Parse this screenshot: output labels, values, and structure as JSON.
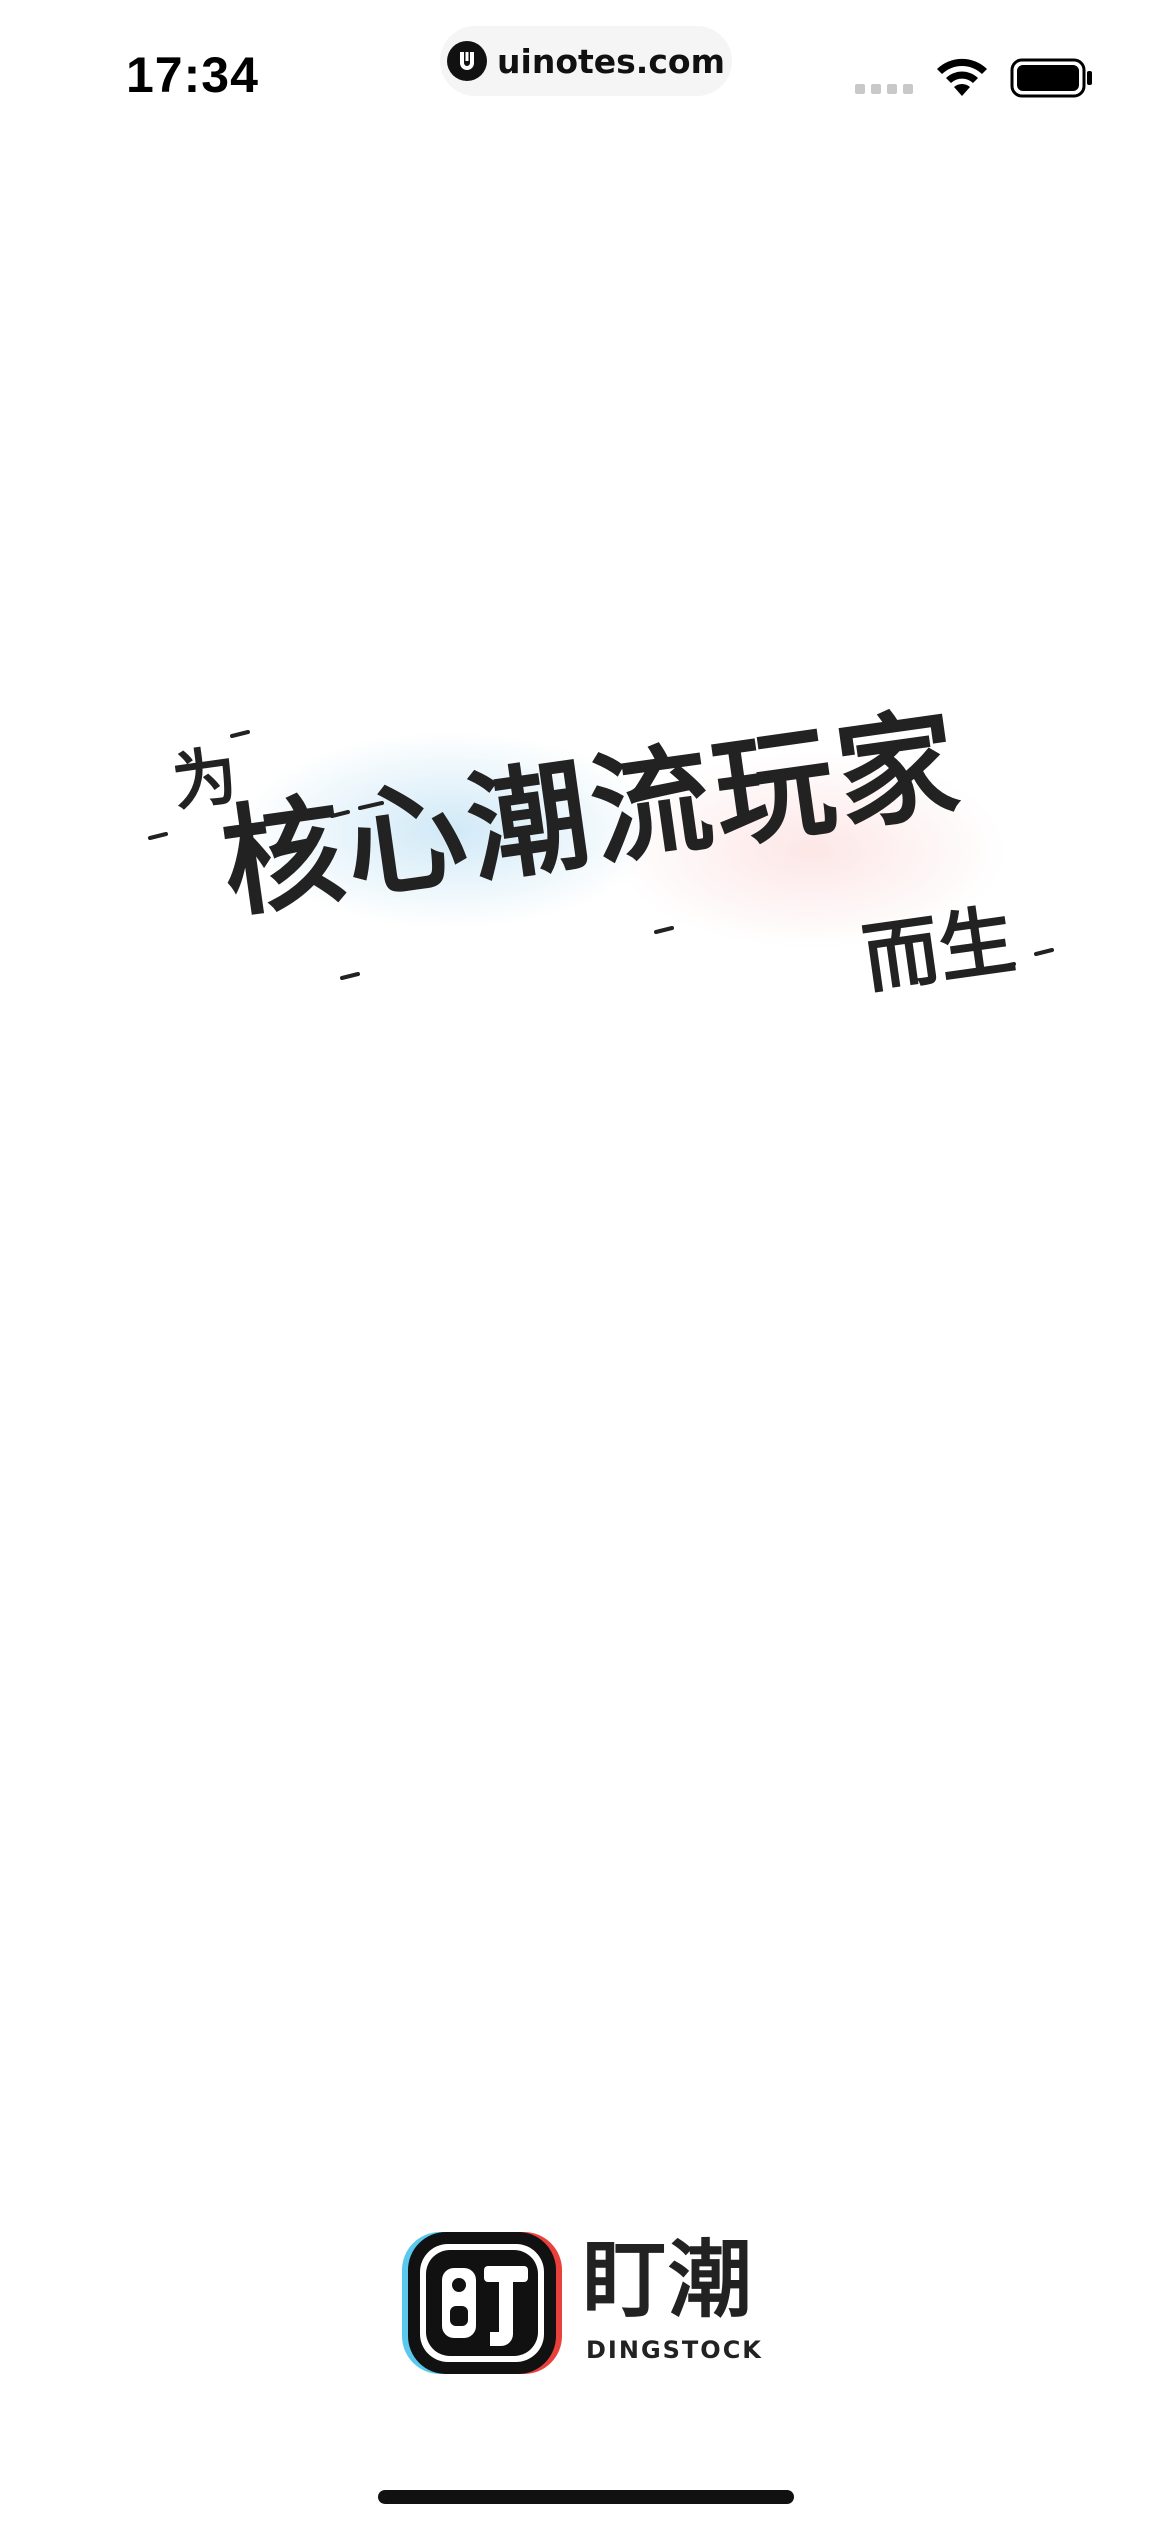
{
  "status_bar": {
    "time": "17:34",
    "url": "uinotes.com",
    "url_logo_icon": "uinotes-logo-icon",
    "wifi_icon": "wifi-icon",
    "battery_icon": "battery-icon",
    "signal_icon": "cellular-signal-icon"
  },
  "splash": {
    "slogan_prefix": "为",
    "slogan_main": "核心潮流玩家",
    "slogan_suffix": "而生"
  },
  "brand": {
    "name_cn": "盯潮",
    "name_en": "DINGSTOCK",
    "logo_icon": "dingstock-logo-icon",
    "colors": {
      "left_accent": "#5bc8ee",
      "right_accent": "#e8413c",
      "ink": "#111111"
    }
  }
}
